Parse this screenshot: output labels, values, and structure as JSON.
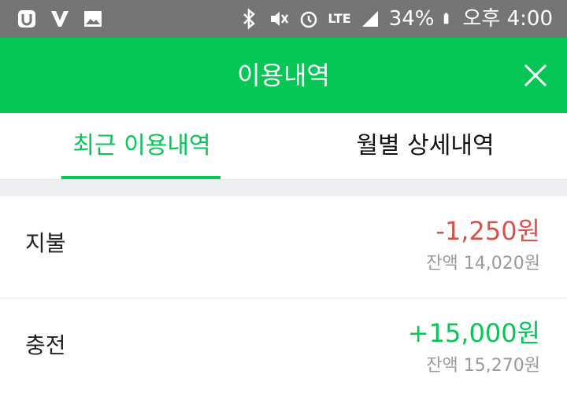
{
  "status_bar": {
    "battery": "34%",
    "time": "오후 4:00",
    "network": "LTE",
    "icons_left": [
      "notification-app-icon",
      "app-icon",
      "image-icon"
    ],
    "icons_right": [
      "bluetooth-icon",
      "mute-icon",
      "alarm-icon",
      "lte-icon",
      "signal-icon",
      "battery-icon"
    ]
  },
  "header": {
    "title": "이용내역",
    "background": "#06c755",
    "close_icon": "close-icon"
  },
  "tabs": [
    {
      "label": "최근 이용내역",
      "active": true
    },
    {
      "label": "월별 상세내역",
      "active": false
    }
  ],
  "transactions": [
    {
      "type": "지불",
      "amount": "-1,250원",
      "balance": "잔액 14,020원",
      "amount_color": "#d6534a"
    },
    {
      "type": "충전",
      "amount": "+15,000원",
      "balance": "잔액 15,270원",
      "amount_color": "#06c755"
    }
  ],
  "colors": {
    "accent": "#06c755",
    "negative": "#d6534a",
    "status_bar": "#757575"
  }
}
